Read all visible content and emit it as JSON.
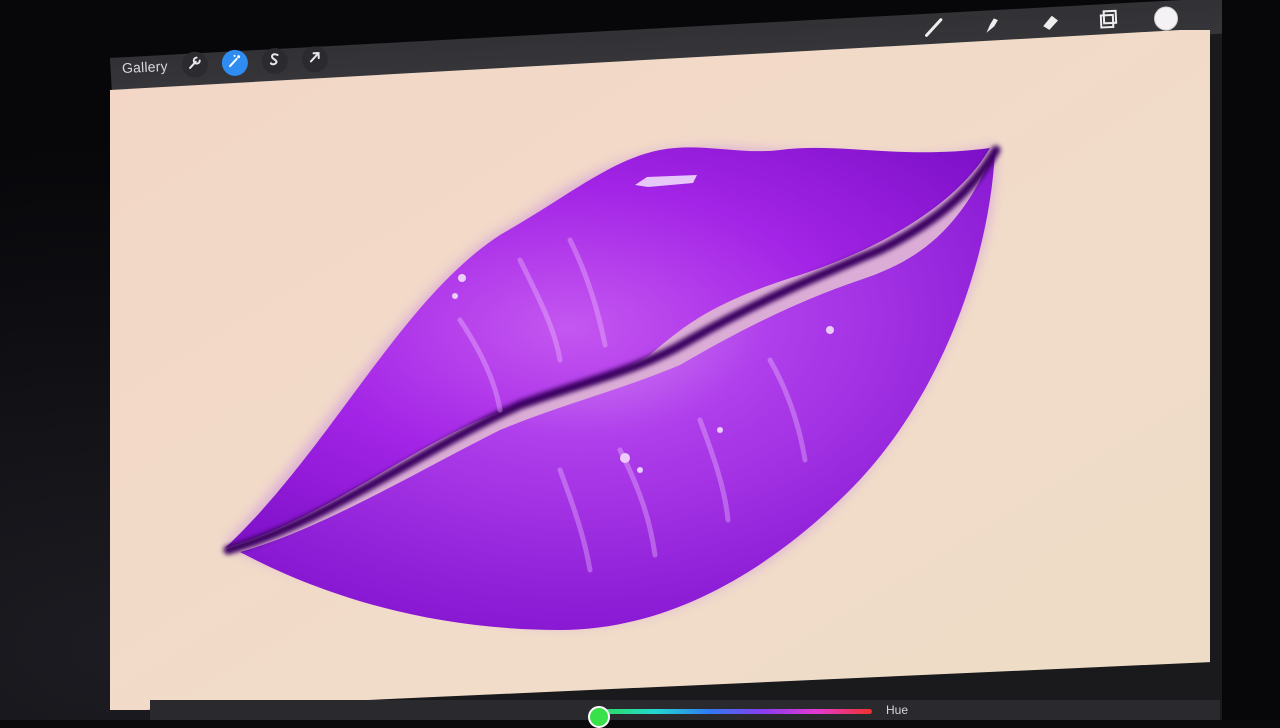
{
  "toolbar": {
    "gallery_label": "Gallery",
    "left_tools": [
      {
        "name": "actions",
        "icon": "wrench-icon"
      },
      {
        "name": "adjustments",
        "icon": "magic-wand-icon",
        "active": true
      },
      {
        "name": "selection",
        "icon": "selection-s-icon"
      },
      {
        "name": "transform",
        "icon": "arrow-cursor-icon"
      }
    ],
    "right_tools": [
      {
        "name": "brush",
        "icon": "brush-icon"
      },
      {
        "name": "smudge",
        "icon": "smudge-finger-icon"
      },
      {
        "name": "eraser",
        "icon": "eraser-icon"
      },
      {
        "name": "layers",
        "icon": "layers-icon"
      },
      {
        "name": "color",
        "icon": "color-swatch"
      }
    ]
  },
  "colors": {
    "active_tool": "#2f8cf0",
    "canvas": "#f0dbc8",
    "lip_main": "#a020f0",
    "lip_shadow": "#5a0a8a",
    "current_color": "#f4f2f4"
  },
  "color_panel": {
    "hue_label": "Hue",
    "hue_position": 0.0
  },
  "artwork": {
    "subject": "lips"
  }
}
